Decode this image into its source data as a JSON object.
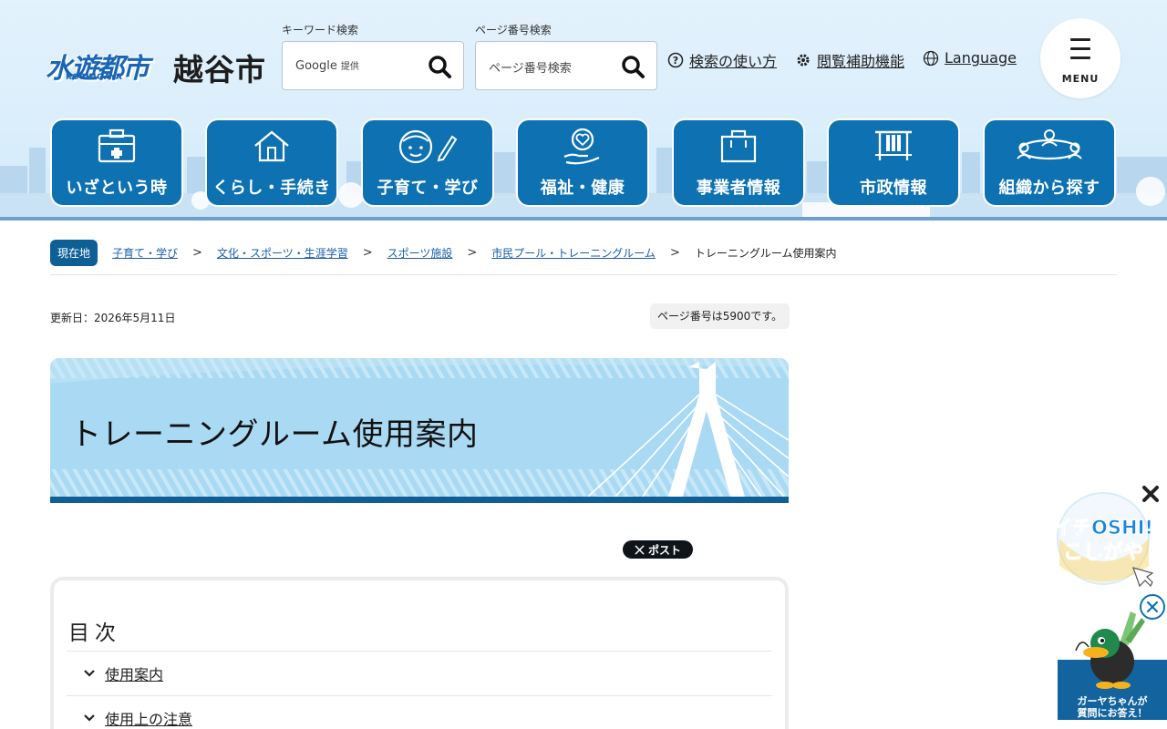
{
  "header": {
    "logo_text": "水遊都市",
    "logo_sub": "KOSHIGAYA",
    "city_name": "越谷市",
    "keyword_search": {
      "label": "キーワード検索",
      "placeholder": "Google",
      "provider_note": "提供"
    },
    "page_search": {
      "label": "ページ番号検索",
      "placeholder": "ページ番号検索"
    },
    "links": {
      "search_help": "検索の使い方",
      "accessibility": "閲覧補助機能",
      "language": "Language"
    },
    "menu_label": "MENU"
  },
  "nav": [
    {
      "label": "いざという時",
      "icon": "first-aid-kit-icon"
    },
    {
      "label": "くらし・手続き",
      "icon": "house-icon"
    },
    {
      "label": "子育て・学び",
      "icon": "child-pencil-icon"
    },
    {
      "label": "福祉・健康",
      "icon": "heart-hand-icon"
    },
    {
      "label": "事業者情報",
      "icon": "briefcase-icon"
    },
    {
      "label": "市政情報",
      "icon": "government-building-icon"
    },
    {
      "label": "組織から探す",
      "icon": "organization-icon"
    }
  ],
  "breadcrumb": {
    "here_label": "現在地",
    "items": [
      "子育て・学び",
      "文化・スポーツ・生涯学習",
      "スポーツ施設",
      "市民プール・トレーニングルーム"
    ],
    "separator": ">",
    "current": "トレーニングルーム使用案内"
  },
  "meta": {
    "updated": "更新日：2026年5月11日",
    "page_number": "ページ番号は5900です。"
  },
  "page_title": "トレーニングルーム使用案内",
  "share": {
    "x_post": "ポスト"
  },
  "toc": {
    "title": "目次",
    "items": [
      "使用案内",
      "使用上の注意"
    ]
  },
  "widgets": {
    "promo_alt": "シティプロモーションサイト イチOSHI!こしがや",
    "chat_text_line1": "ガーヤちゃんが",
    "chat_text_line2": "質問にお答え！"
  },
  "colors": {
    "primary": "#0d71b2",
    "dark": "#0d5f96",
    "banner": "#a9d9f3",
    "link": "#1a5ea8"
  }
}
